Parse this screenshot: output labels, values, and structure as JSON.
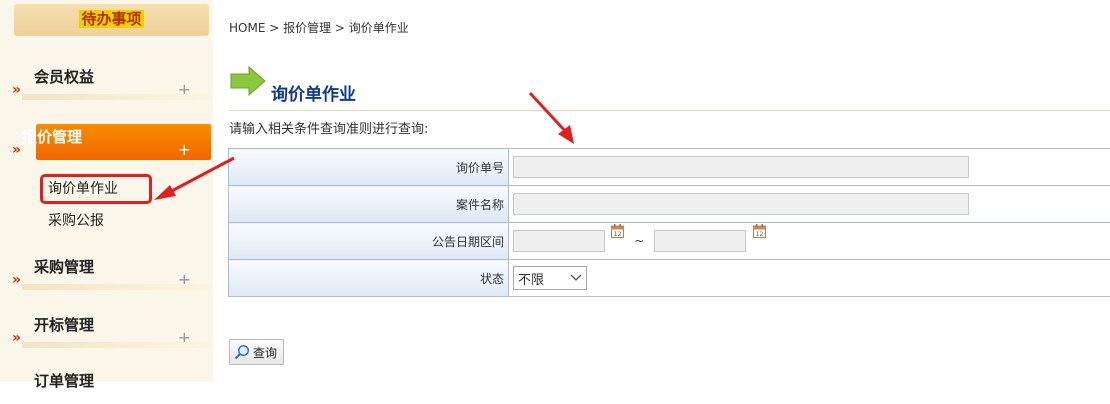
{
  "sidebar": {
    "top_label": "待办事项",
    "menus": [
      {
        "title": "会员权益",
        "plus": "+"
      },
      {
        "title": "报价管理",
        "plus": "+"
      },
      {
        "title": "采购管理",
        "plus": "+"
      },
      {
        "title": "开标管理",
        "plus": "+"
      },
      {
        "title": "订单管理",
        "plus": ""
      }
    ],
    "subitems": [
      "询价单作业",
      "采购公报"
    ]
  },
  "breadcrumb": "HOME > 报价管理 > 询价单作业",
  "page_title": "询价单作业",
  "hint": "请输入相关条件查询准则进行查询:",
  "form": {
    "labels": [
      "询价单号",
      "案件名称",
      "公告日期区间",
      "状态"
    ],
    "tilde": "~",
    "status_selected": "不限"
  },
  "query_button": "查询",
  "colors": {
    "accent_orange": "#f07a00",
    "title_blue": "#113a88",
    "annotation_red": "#e02020"
  }
}
